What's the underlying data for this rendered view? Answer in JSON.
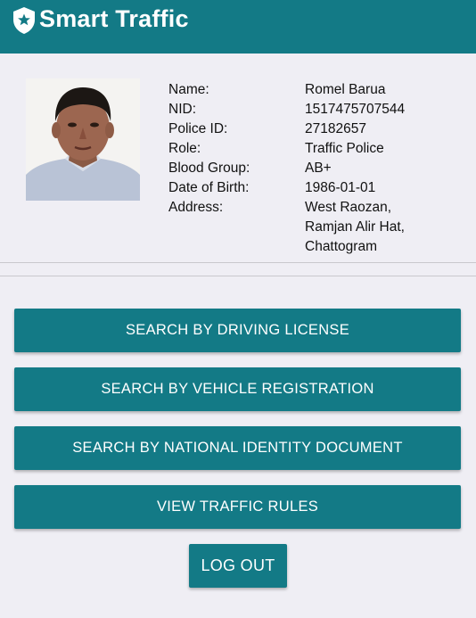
{
  "app": {
    "title": "Smart Traffic",
    "brand_color": "#137a86",
    "logo_icon": "police-badge-star-icon"
  },
  "profile": {
    "photo_icon": "officer-photo",
    "fields": [
      {
        "label": "Name:",
        "value": "Romel Barua"
      },
      {
        "label": "NID:",
        "value": "1517475707544"
      },
      {
        "label": "Police ID:",
        "value": "27182657"
      },
      {
        "label": "Role:",
        "value": "Traffic Police"
      },
      {
        "label": "Blood Group:",
        "value": "AB+"
      },
      {
        "label": "Date of Birth:",
        "value": "1986-01-01"
      },
      {
        "label": "Address:",
        "value": "West Raozan,\nRamjan Alir Hat,\nChattogram"
      }
    ]
  },
  "actions": {
    "search_driving_license": "SEARCH BY DRIVING LICENSE",
    "search_vehicle_registration": "SEARCH BY VEHICLE REGISTRATION",
    "search_national_id": "SEARCH BY NATIONAL IDENTITY DOCUMENT",
    "view_traffic_rules": "VIEW TRAFFIC RULES",
    "log_out": "LOG OUT"
  }
}
